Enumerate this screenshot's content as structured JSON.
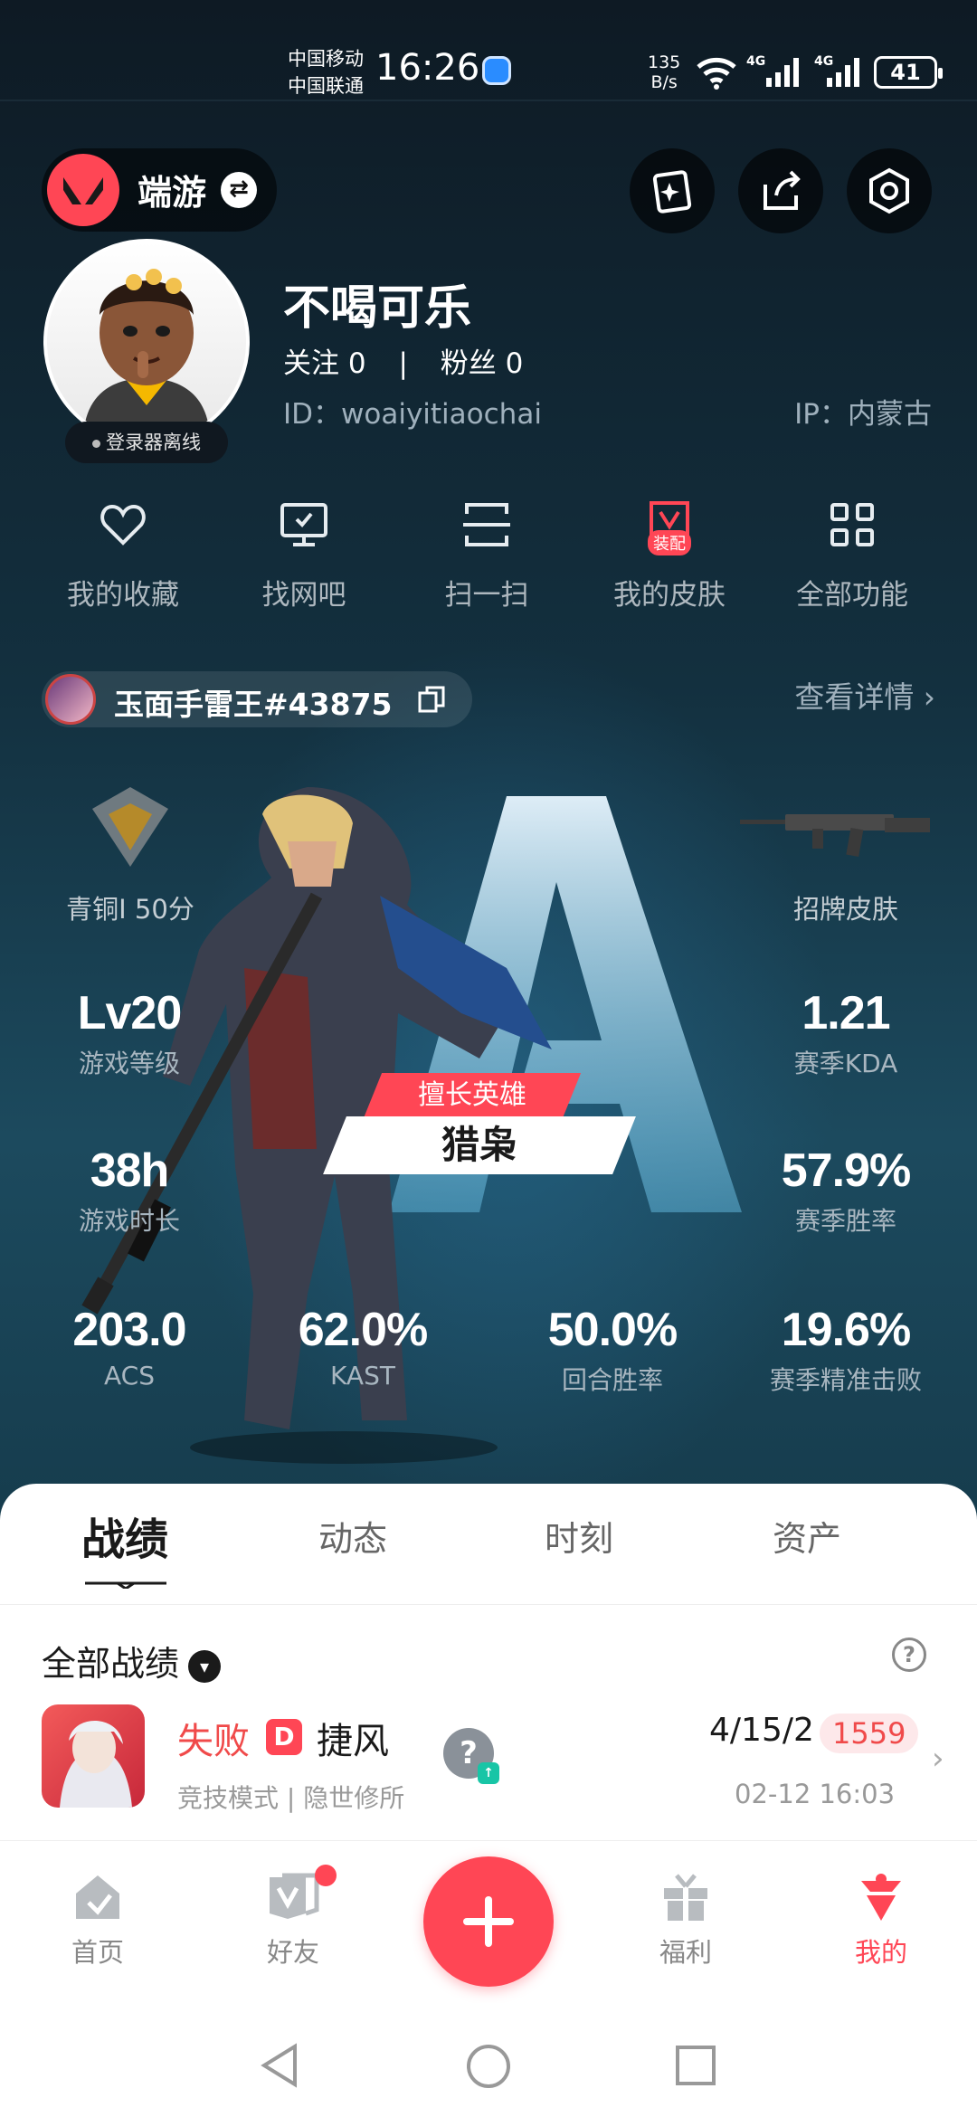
{
  "status_bar": {
    "carrier1": "中国移动",
    "carrier2": "中国联通",
    "time": "16:26",
    "net_speed_value": "135",
    "net_speed_unit": "B/s",
    "sig1_label": "4G",
    "sig2_label": "4G",
    "battery": "41"
  },
  "header": {
    "app_name": "端游"
  },
  "profile": {
    "nickname": "不喝可乐",
    "follow_label": "关注",
    "follow_count": "0",
    "divider": "|",
    "fans_label": "粉丝",
    "fans_count": "0",
    "id_text": "ID：woaiyitiaochai",
    "ip_text": "IP：内蒙古",
    "launcher_status": "登录器离线"
  },
  "quick_actions": [
    {
      "label": "我的收藏",
      "icon": "heart-icon"
    },
    {
      "label": "找网吧",
      "icon": "monitor-icon"
    },
    {
      "label": "扫一扫",
      "icon": "scan-icon"
    },
    {
      "label": "我的皮肤",
      "icon": "skin-icon",
      "badge": "装配"
    },
    {
      "label": "全部功能",
      "icon": "grid-icon"
    }
  ],
  "riot": {
    "name": "玉面手雷王#43875",
    "detail_link": "查看详情 ›"
  },
  "stats": {
    "rank_label": "青铜I 50分",
    "skin_label": "招牌皮肤",
    "level": {
      "value": "Lv20",
      "label": "游戏等级"
    },
    "kda": {
      "value": "1.21",
      "label": "赛季KDA"
    },
    "hours": {
      "value": "38h",
      "label": "游戏时长"
    },
    "winrate": {
      "value": "57.9%",
      "label": "赛季胜率"
    },
    "acs": {
      "value": "203.0",
      "label": "ACS"
    },
    "kast": {
      "value": "62.0%",
      "label": "KAST"
    },
    "round_win": {
      "value": "50.0%",
      "label": "回合胜率"
    },
    "headshot": {
      "value": "19.6%",
      "label": "赛季精准击败"
    },
    "best_agent_tag": "擅长英雄",
    "best_agent": "猎枭"
  },
  "tabs": [
    {
      "label": "战绩",
      "active": true
    },
    {
      "label": "动态"
    },
    {
      "label": "时刻"
    },
    {
      "label": "资产"
    }
  ],
  "record": {
    "filter_label": "全部战绩",
    "match": {
      "result": "失败",
      "rank_letter": "D",
      "map": "捷风",
      "mode": "竞技模式 | 隐世修所",
      "kda": "4/15/2",
      "rr": "1559",
      "time": "02-12 16:03",
      "unknown_agent": "?"
    }
  },
  "bottom_nav": [
    {
      "label": "首页",
      "icon": "home-icon"
    },
    {
      "label": "好友",
      "icon": "friends-icon"
    },
    {
      "label": "福利",
      "icon": "gift-icon"
    },
    {
      "label": "我的",
      "icon": "profile-icon",
      "active": true
    }
  ],
  "colors": {
    "accent": "#ff4655",
    "hero_bg": "#13303f",
    "loss_text": "#f04a4a"
  }
}
